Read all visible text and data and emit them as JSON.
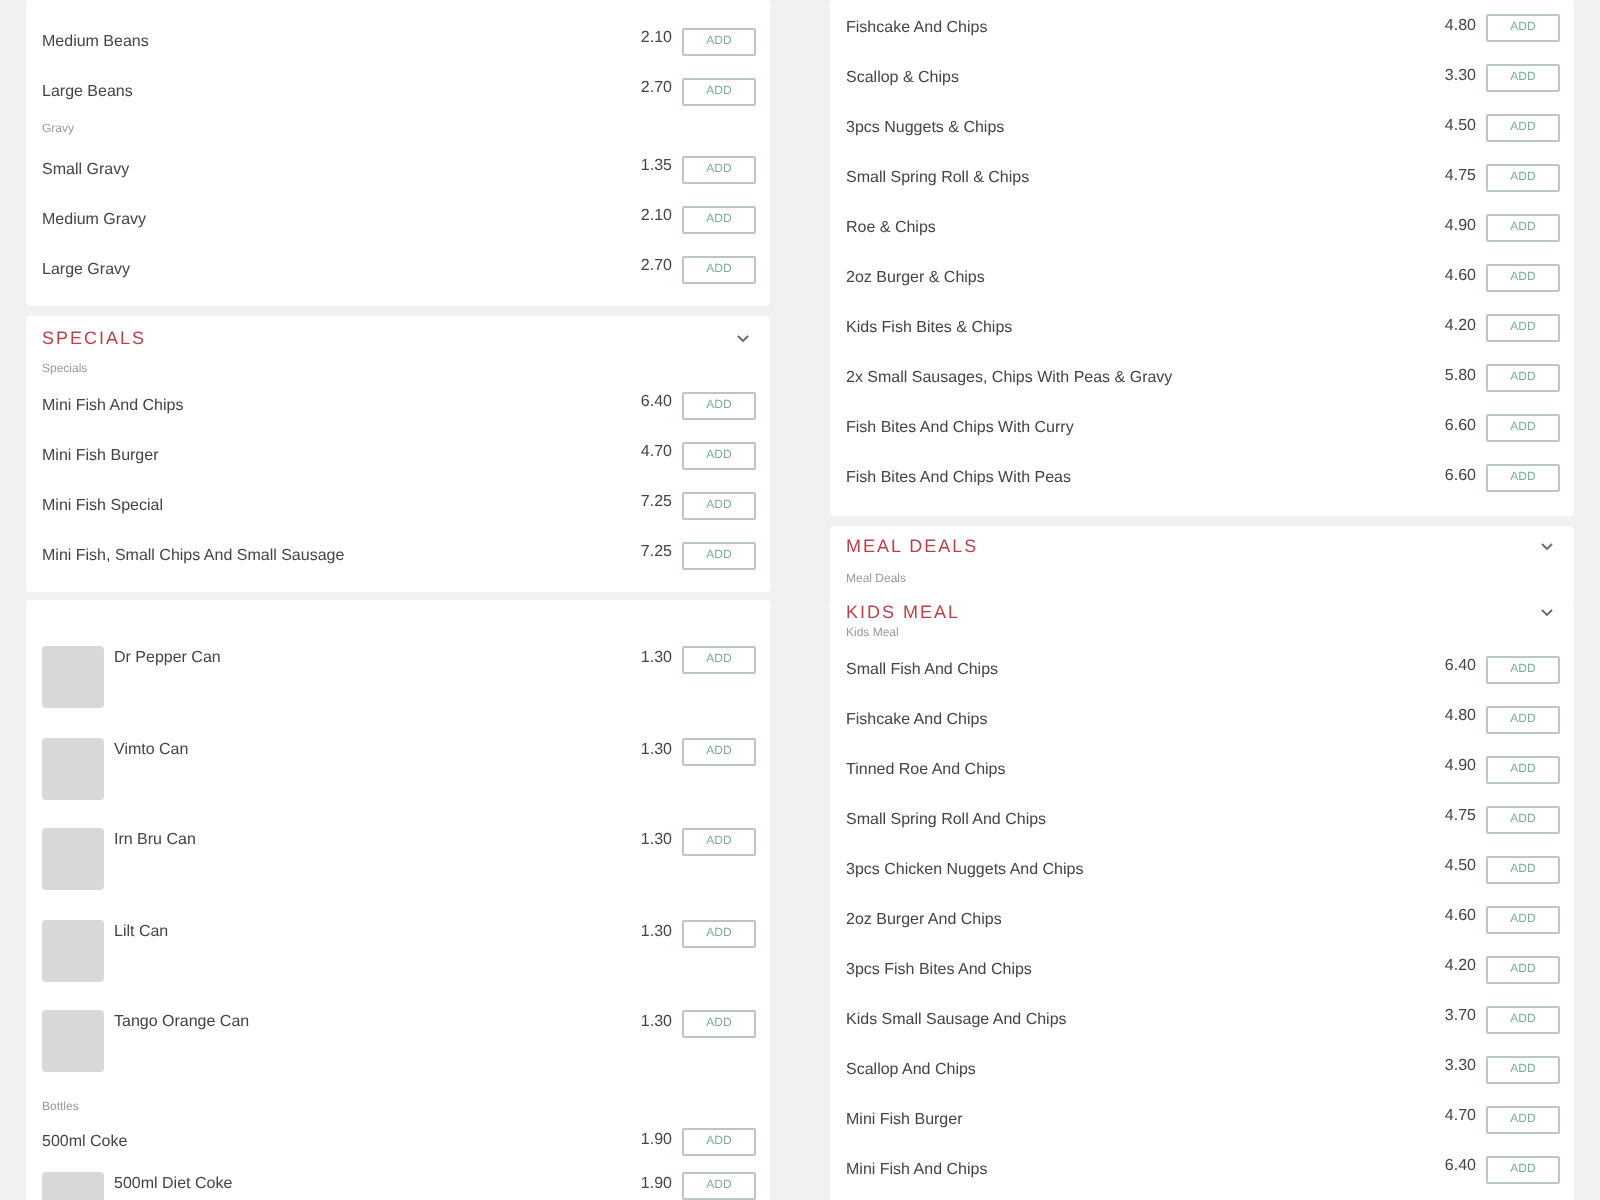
{
  "panels": [
    {
      "cards": [
        {
          "items": [
            {
              "kind": "item",
              "name": "Medium Beans",
              "price": "2.10",
              "button": "ADD"
            },
            {
              "kind": "item",
              "name": "Large Beans",
              "price": "2.70",
              "button": "ADD"
            },
            {
              "kind": "subheading",
              "name": "Gravy"
            },
            {
              "kind": "item",
              "name": "Small Gravy",
              "price": "1.35",
              "button": "ADD"
            },
            {
              "kind": "item",
              "name": "Medium Gravy",
              "price": "2.10",
              "button": "ADD"
            },
            {
              "kind": "item",
              "name": "Large Gravy",
              "price": "2.70",
              "button": "ADD"
            }
          ]
        },
        {
          "title": "SPECIALS",
          "items": [
            {
              "kind": "subheading",
              "name": "Specials"
            },
            {
              "kind": "item",
              "name": "Mini Fish And Chips",
              "price": "6.40",
              "button": "ADD"
            },
            {
              "kind": "item",
              "name": "Mini Fish Burger",
              "price": "4.70",
              "button": "ADD"
            },
            {
              "kind": "item",
              "name": "Mini Fish Special",
              "price": "7.25",
              "button": "ADD"
            },
            {
              "kind": "item",
              "name": "Mini Fish, Small Chips And Small Sausage",
              "price": "7.25",
              "button": "ADD"
            }
          ]
        }
      ]
    },
    {
      "cards": [
        {
          "items": [
            {
              "kind": "item",
              "name": "Fishcake And Chips",
              "price": "4.80",
              "button": "ADD"
            },
            {
              "kind": "item",
              "name": "Scallop & Chips",
              "price": "3.30",
              "button": "ADD"
            },
            {
              "kind": "item",
              "name": "3pcs Nuggets & Chips",
              "price": "4.50",
              "button": "ADD"
            },
            {
              "kind": "item",
              "name": "Small Spring Roll & Chips",
              "price": "4.75",
              "button": "ADD"
            },
            {
              "kind": "item",
              "name": "Roe & Chips",
              "price": "4.90",
              "button": "ADD"
            },
            {
              "kind": "item",
              "name": "2oz Burger & Chips",
              "price": "4.60",
              "button": "ADD"
            },
            {
              "kind": "item",
              "name": "Kids Fish Bites & Chips",
              "price": "4.20",
              "button": "ADD"
            },
            {
              "kind": "item",
              "name": "2x Small Sausages, Chips With Peas & Gravy",
              "price": "5.80",
              "button": "ADD"
            },
            {
              "kind": "item",
              "name": "Fish Bites And Chips With Curry",
              "price": "6.60",
              "button": "ADD"
            },
            {
              "kind": "item",
              "name": "Fish Bites And Chips With Peas",
              "price": "6.60",
              "button": "ADD"
            }
          ]
        },
        {
          "title": "MEAL DEALS",
          "items": [
            {
              "kind": "subheading",
              "name": "Meal Deals"
            }
          ]
        }
      ]
    },
    {
      "cards": [
        {
          "items": [
            {
              "kind": "photo_item",
              "name": "Dr Pepper Can",
              "price": "1.30",
              "button": "ADD"
            },
            {
              "kind": "photo_item",
              "name": "Vimto Can",
              "price": "1.30",
              "button": "ADD"
            },
            {
              "kind": "photo_item",
              "name": "Irn Bru Can",
              "price": "1.30",
              "button": "ADD"
            },
            {
              "kind": "photo_item",
              "name": "Lilt Can",
              "price": "1.30",
              "button": "ADD"
            },
            {
              "kind": "photo_item",
              "name": "Tango Orange Can",
              "price": "1.30",
              "button": "ADD"
            },
            {
              "kind": "subheading",
              "name": "Bottles"
            },
            {
              "kind": "item",
              "name": "500ml Coke",
              "price": "1.90",
              "button": "ADD"
            },
            {
              "kind": "photo_item",
              "name": "500ml Diet Coke",
              "price": "1.90",
              "button": "ADD"
            }
          ]
        }
      ]
    },
    {
      "cards": [
        {
          "title": "KIDS MEAL",
          "items": [
            {
              "kind": "subheading",
              "name": "Kids Meal"
            },
            {
              "kind": "item",
              "name": "Small Fish And Chips",
              "price": "6.40",
              "button": "ADD"
            },
            {
              "kind": "item",
              "name": "Fishcake And Chips",
              "price": "4.80",
              "button": "ADD"
            },
            {
              "kind": "item",
              "name": "Tinned Roe And Chips",
              "price": "4.90",
              "button": "ADD"
            },
            {
              "kind": "item",
              "name": "Small Spring Roll And Chips",
              "price": "4.75",
              "button": "ADD"
            },
            {
              "kind": "item",
              "name": "3pcs Chicken Nuggets And Chips",
              "price": "4.50",
              "button": "ADD"
            },
            {
              "kind": "item",
              "name": "2oz Burger And Chips",
              "price": "4.60",
              "button": "ADD"
            },
            {
              "kind": "item",
              "name": "3pcs Fish Bites And Chips",
              "price": "4.20",
              "button": "ADD"
            },
            {
              "kind": "item",
              "name": "Kids Small Sausage And Chips",
              "price": "3.70",
              "button": "ADD"
            },
            {
              "kind": "item",
              "name": "Scallop And Chips",
              "price": "3.30",
              "button": "ADD"
            },
            {
              "kind": "item",
              "name": "Mini Fish Burger",
              "price": "4.70",
              "button": "ADD"
            },
            {
              "kind": "item",
              "name": "Mini Fish And Chips",
              "price": "6.40",
              "button": "ADD"
            }
          ]
        }
      ]
    }
  ]
}
